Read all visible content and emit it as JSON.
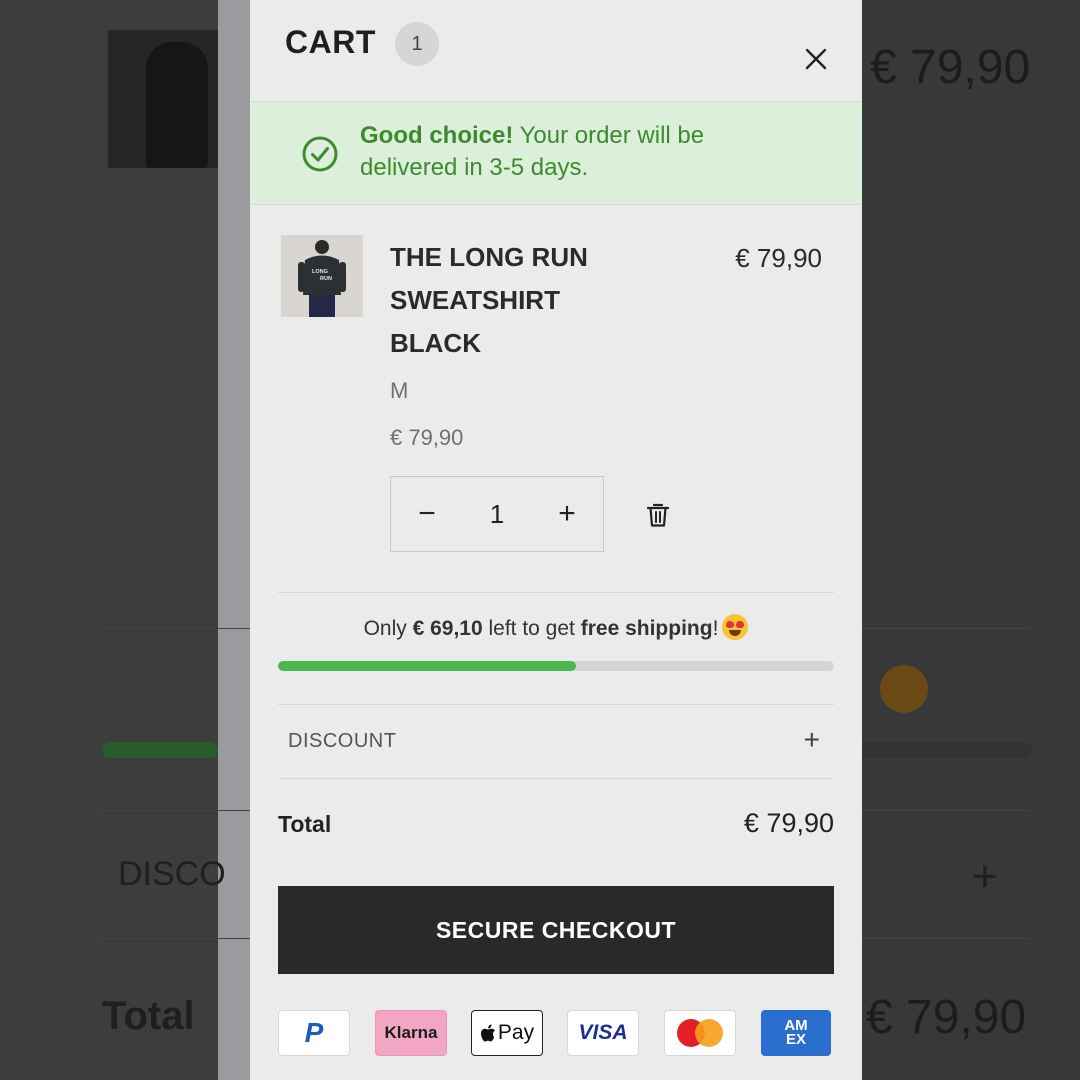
{
  "background_page": {
    "price": "€ 79,90",
    "discount_label": "DISCO",
    "plus": "+",
    "total_label": "Total",
    "total_price": "€ 79,90"
  },
  "cart": {
    "title": "CART",
    "count": "1",
    "close_icon": "close-icon",
    "notice": {
      "bold": "Good choice!",
      "text": " Your order will be delivered in 3-5 days.",
      "icon": "check-circle-icon",
      "color": "#3e8a2f",
      "background": "#dbefda"
    },
    "item": {
      "name": "THE LONG RUN SWEATSHIRT BLACK",
      "price": "€ 79,90",
      "size": "M",
      "unit_price": "€ 79,90",
      "quantity": "1",
      "minus": "−",
      "plus": "+",
      "image_text_line1": "LONG",
      "image_text_line2": "RUN"
    },
    "shipping": {
      "prefix": "Only ",
      "amount": "€ 69,10",
      "middle": " left to get ",
      "highlight": "free shipping",
      "suffix": "!",
      "emoji": "heart-eyes-emoji",
      "progress_percent": 53.6,
      "bar_color": "#4bb84e"
    },
    "discount": {
      "label": "DISCOUNT",
      "plus": "+"
    },
    "total": {
      "label": "Total",
      "value": "€ 79,90"
    },
    "checkout_label": "SECURE CHECKOUT",
    "payment_methods": {
      "paypal": "P",
      "klarna": "Klarna",
      "apple_pay": "Pay",
      "visa": "VISA",
      "mastercard": "mastercard-icon",
      "amex_line1": "AM",
      "amex_line2": "EX"
    }
  }
}
